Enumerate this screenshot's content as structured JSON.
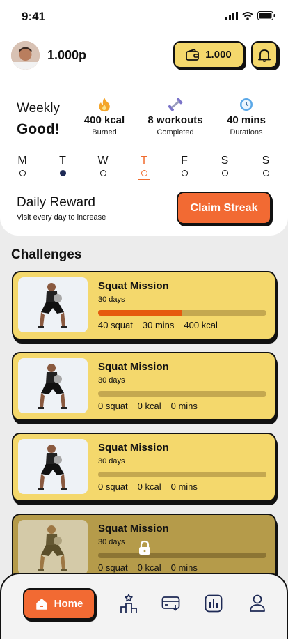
{
  "status_bar": {
    "time": "9:41"
  },
  "header": {
    "points": "1.000p",
    "wallet_balance": "1.000"
  },
  "weekly": {
    "label": "Weekly",
    "status": "Good!",
    "stats": [
      {
        "icon": "flame-icon",
        "value": "400 kcal",
        "label": "Burned"
      },
      {
        "icon": "dumbbell-icon",
        "value": "8 workouts",
        "label": "Completed"
      },
      {
        "icon": "clock-icon",
        "value": "40 mins",
        "label": "Durations"
      }
    ],
    "days": [
      "M",
      "T",
      "W",
      "T",
      "F",
      "S",
      "S"
    ]
  },
  "reward": {
    "title": "Daily Reward",
    "subtitle": "Visit every day to  increase",
    "button": "Claim Streak"
  },
  "challenges": {
    "title": "Challenges",
    "items": [
      {
        "title": "Squat Mission",
        "days": "30 days",
        "progress": 0.5,
        "stat1": "40 squat",
        "stat2": "30 mins",
        "stat3": "400 kcal",
        "locked": false
      },
      {
        "title": "Squat Mission",
        "days": "30 days",
        "progress": 0,
        "stat1": "0 squat",
        "stat2": "0 kcal",
        "stat3": "0 mins",
        "locked": false
      },
      {
        "title": "Squat Mission",
        "days": "30 days",
        "progress": 0,
        "stat1": "0 squat",
        "stat2": "0 kcal",
        "stat3": "0 mins",
        "locked": false
      },
      {
        "title": "Squat Mission",
        "days": "30 days",
        "progress": 0,
        "stat1": "0 squat",
        "stat2": "0 kcal",
        "stat3": "0 mins",
        "locked": true
      }
    ]
  },
  "nav": {
    "home_label": "Home"
  },
  "colors": {
    "accent": "#f26a33",
    "card": "#f4d86c",
    "locked_card": "#b59b4a",
    "progress": "#e65a0e"
  }
}
